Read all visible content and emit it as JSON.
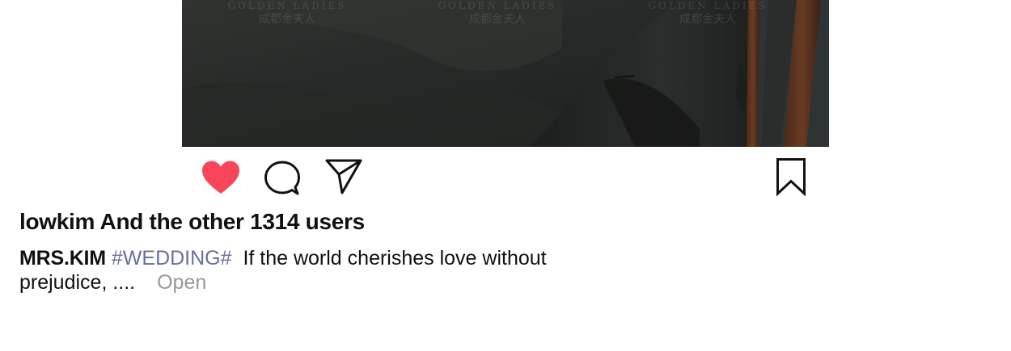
{
  "photo": {
    "watermark": {
      "en": "GOLDEN LADIES",
      "cn": "成都金夫人"
    }
  },
  "actions": {
    "like_icon": "heart-filled-icon",
    "comment_icon": "speech-bubble-icon",
    "share_icon": "paper-plane-icon",
    "save_icon": "bookmark-icon",
    "like_color": "#f9455a"
  },
  "likes_text": "lowkim And the other 1314 users",
  "caption": {
    "author": "MRS.KIM",
    "hashtag": "#WEDDING#",
    "text_line1": "If the world cherishes love without",
    "text_line2": "prejudice, ....",
    "more_label": "Open"
  }
}
